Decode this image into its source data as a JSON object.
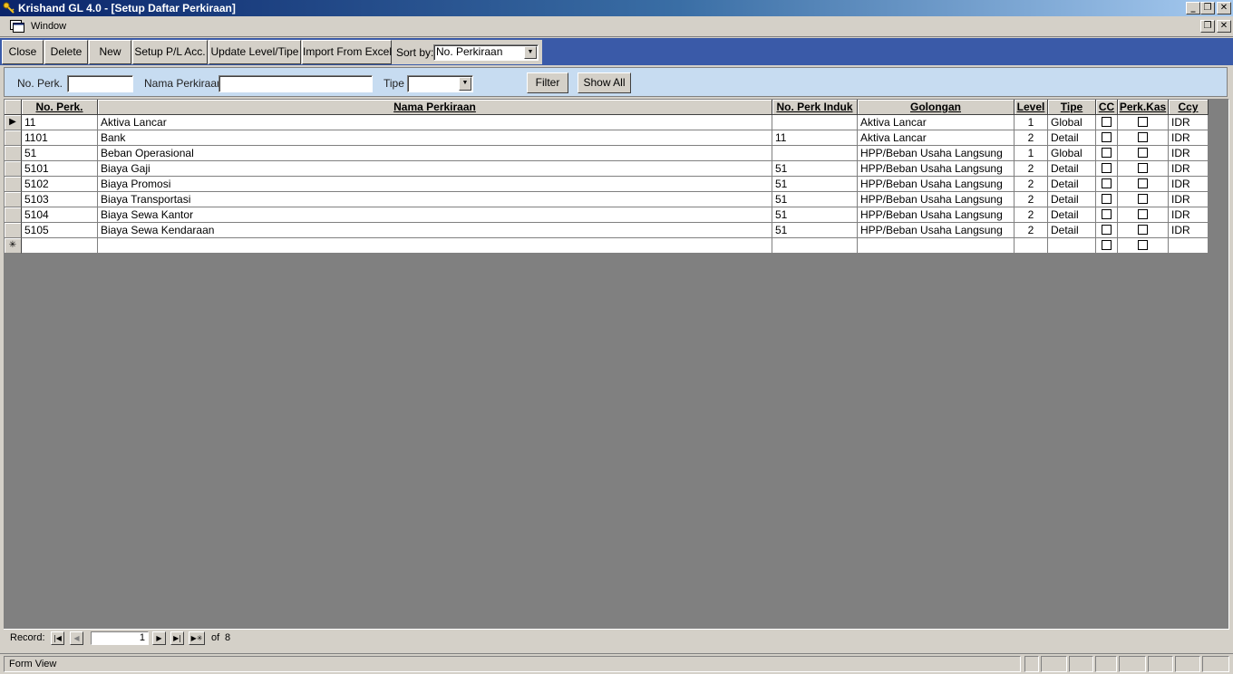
{
  "window": {
    "title": "Krishand GL 4.0 - [Setup Daftar Perkiraan]",
    "minimize": "_",
    "restore": "❐",
    "close": "✕"
  },
  "menu": {
    "window_label": "Window"
  },
  "toolbar": {
    "close_label": "Close",
    "delete_label": "Delete",
    "new_label": "New",
    "setup_pl_label": "Setup P/L Acc.",
    "update_level_label": "Update Level/Tipe",
    "import_label": "Import From Excel",
    "sort_by_label": "Sort by:",
    "sort_by_value": "No. Perkiraan"
  },
  "filter": {
    "no_perk_label": "No. Perk.",
    "no_perk_value": "",
    "nama_label": "Nama Perkiraan",
    "nama_value": "",
    "tipe_label": "Tipe",
    "tipe_value": "",
    "filter_button": "Filter",
    "show_all_button": "Show All"
  },
  "grid": {
    "columns": [
      "No. Perk.",
      "Nama Perkiraan",
      "No. Perk Induk",
      "Golongan",
      "Level",
      "Tipe",
      "CC",
      "Perk.Kas",
      "Ccy"
    ],
    "rows": [
      {
        "no": "11",
        "nama": "Aktiva Lancar",
        "induk": "",
        "golongan": "Aktiva Lancar",
        "level": "1",
        "tipe": "Global",
        "cc": false,
        "kas": false,
        "ccy": "IDR"
      },
      {
        "no": "1101",
        "nama": "Bank",
        "induk": "11",
        "golongan": "Aktiva Lancar",
        "level": "2",
        "tipe": "Detail",
        "cc": false,
        "kas": false,
        "ccy": "IDR"
      },
      {
        "no": "51",
        "nama": "Beban Operasional",
        "induk": "",
        "golongan": "HPP/Beban Usaha Langsung",
        "level": "1",
        "tipe": "Global",
        "cc": false,
        "kas": false,
        "ccy": "IDR"
      },
      {
        "no": "5101",
        "nama": "Biaya Gaji",
        "induk": "51",
        "golongan": "HPP/Beban Usaha Langsung",
        "level": "2",
        "tipe": "Detail",
        "cc": false,
        "kas": false,
        "ccy": "IDR"
      },
      {
        "no": "5102",
        "nama": "Biaya Promosi",
        "induk": "51",
        "golongan": "HPP/Beban Usaha Langsung",
        "level": "2",
        "tipe": "Detail",
        "cc": false,
        "kas": false,
        "ccy": "IDR"
      },
      {
        "no": "5103",
        "nama": "Biaya Transportasi",
        "induk": "51",
        "golongan": "HPP/Beban Usaha Langsung",
        "level": "2",
        "tipe": "Detail",
        "cc": false,
        "kas": false,
        "ccy": "IDR"
      },
      {
        "no": "5104",
        "nama": "Biaya Sewa Kantor",
        "induk": "51",
        "golongan": "HPP/Beban Usaha Langsung",
        "level": "2",
        "tipe": "Detail",
        "cc": false,
        "kas": false,
        "ccy": "IDR"
      },
      {
        "no": "5105",
        "nama": "Biaya Sewa Kendaraan",
        "induk": "51",
        "golongan": "HPP/Beban Usaha Langsung",
        "level": "2",
        "tipe": "Detail",
        "cc": false,
        "kas": false,
        "ccy": "IDR"
      }
    ],
    "selector_current": "▶",
    "selector_new": "✳"
  },
  "nav": {
    "record_label": "Record:",
    "current": "1",
    "of_label": "of",
    "total": "8",
    "first_icon": "first-record-icon",
    "prev_icon": "prev-record-icon",
    "next_icon": "next-record-icon",
    "last_icon": "last-record-icon",
    "new_icon": "new-record-icon"
  },
  "status": {
    "text": "Form View"
  },
  "colors": {
    "title_start": "#0a246a",
    "title_end": "#a6caf0",
    "toolbar_band": "#3a5aa8",
    "filter_panel": "#c7dcf1",
    "grid_background": "#808080"
  }
}
